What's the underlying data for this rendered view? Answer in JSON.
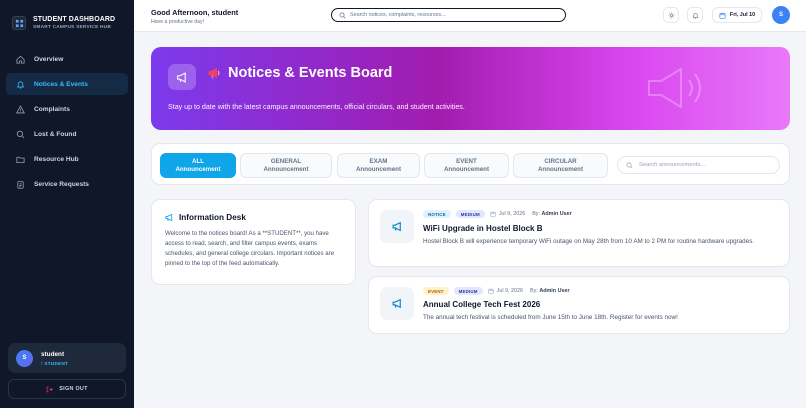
{
  "brand": {
    "title": "STUDENT DASHBOARD",
    "subtitle": "SMART CAMPUS SERVICE HUB"
  },
  "sidebar": {
    "items": [
      {
        "label": "Overview",
        "icon": "home-icon"
      },
      {
        "label": "Notices & Events",
        "icon": "bell-icon",
        "active": true
      },
      {
        "label": "Complaints",
        "icon": "warning-icon"
      },
      {
        "label": "Lost & Found",
        "icon": "search-icon"
      },
      {
        "label": "Resource Hub",
        "icon": "folder-icon"
      },
      {
        "label": "Service Requests",
        "icon": "clipboard-icon"
      }
    ],
    "user": {
      "initial": "S",
      "name": "student",
      "role": "STUDENT"
    },
    "signout_label": "SIGN OUT"
  },
  "topbar": {
    "greeting": "Good Afternoon, student",
    "subgreeting": "Have a productive day!",
    "search_placeholder": "Search notices, complaints, resources...",
    "date": "Fri, Jul 10",
    "avatar_initial": "S"
  },
  "hero": {
    "title": "Notices & Events Board",
    "description": "Stay up to date with the latest campus announcements, official circulars, and student activities.",
    "gradient": [
      "#7c3aed",
      "#d946ef"
    ]
  },
  "filters": {
    "buttons": [
      {
        "line1": "ALL",
        "line2": "Announcement",
        "active": true
      },
      {
        "line1": "GENERAL",
        "line2": "Announcement"
      },
      {
        "line1": "EXAM",
        "line2": "Announcement"
      },
      {
        "line1": "EVENT",
        "line2": "Announcement"
      },
      {
        "line1": "CIRCULAR",
        "line2": "Announcement"
      }
    ],
    "search_placeholder": "Search announcements..."
  },
  "info_desk": {
    "title": "Information Desk",
    "text": "Welcome to the notices board! As a **STUDENT**, you have access to read, search, and filter campus events, exams schedules, and general college circulars. Important notices are pinned to the top of the feed automatically."
  },
  "notices": [
    {
      "type": "NOTICE",
      "priority": "MEDIUM",
      "date": "Jul 9, 2026",
      "by_label": "By:",
      "author": "Admin User",
      "title": "WiFi Upgrade in Hostel Block B",
      "description": "Hostel Block B will experience temporary WiFi outage on May 28th from 10 AM to 2 PM for routine hardware upgrades."
    },
    {
      "type": "EVENT",
      "priority": "MEDIUM",
      "date": "Jul 9, 2026",
      "by_label": "By:",
      "author": "Admin User",
      "title": "Annual College Tech Fest 2026",
      "description": "The annual tech festival is scheduled from June 15th to June 18th. Register for events now!"
    }
  ],
  "colors": {
    "accent": "#0ea5e9",
    "sidebar_bg": "#0f1729",
    "active_nav": "#38bdf8"
  }
}
